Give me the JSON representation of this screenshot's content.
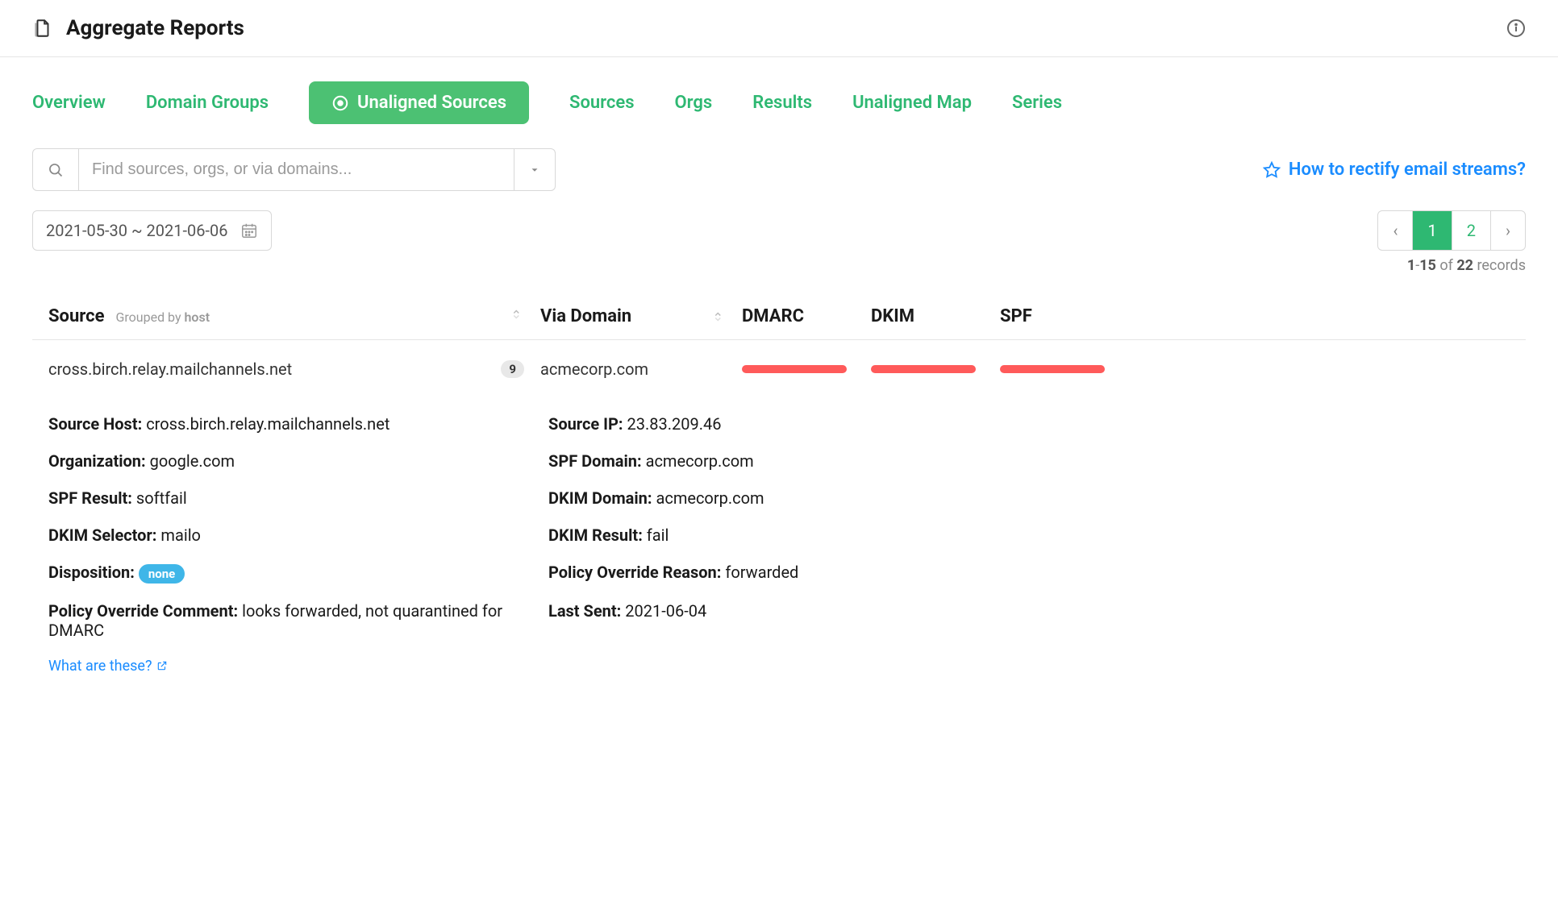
{
  "header": {
    "title": "Aggregate Reports"
  },
  "tabs": {
    "items": [
      {
        "label": "Overview"
      },
      {
        "label": "Domain Groups"
      },
      {
        "label": "Unaligned Sources"
      },
      {
        "label": "Sources"
      },
      {
        "label": "Orgs"
      },
      {
        "label": "Results"
      },
      {
        "label": "Unaligned Map"
      },
      {
        "label": "Series"
      }
    ],
    "activeIndex": 2
  },
  "search": {
    "placeholder": "Find sources, orgs, or via domains..."
  },
  "helpLink": "How to rectify email streams?",
  "dateRange": "2021-05-30 ~ 2021-06-06",
  "pagination": {
    "pages": [
      "1",
      "2"
    ],
    "activePage": "1",
    "rangeStart": "1",
    "rangeEnd": "15",
    "total": "22",
    "recordsWord": "records",
    "ofWord": "of"
  },
  "tableHeaders": {
    "source": "Source",
    "groupedBy": "Grouped by",
    "groupedByField": "host",
    "viaDomain": "Via Domain",
    "dmarc": "DMARC",
    "dkim": "DKIM",
    "spf": "SPF"
  },
  "row": {
    "source": "cross.birch.relay.mailchannels.net",
    "count": "9",
    "viaDomain": "acmecorp.com"
  },
  "details": {
    "sourceHostLabel": "Source Host:",
    "sourceHost": "cross.birch.relay.mailchannels.net",
    "sourceIpLabel": "Source IP:",
    "sourceIp": "23.83.209.46",
    "orgLabel": "Organization:",
    "org": "google.com",
    "spfDomainLabel": "SPF Domain:",
    "spfDomain": "acmecorp.com",
    "spfResultLabel": "SPF Result:",
    "spfResult": "softfail",
    "dkimDomainLabel": "DKIM Domain:",
    "dkimDomain": "acmecorp.com",
    "dkimSelectorLabel": "DKIM Selector:",
    "dkimSelector": "mailo",
    "dkimResultLabel": "DKIM Result:",
    "dkimResult": "fail",
    "dispositionLabel": "Disposition:",
    "disposition": "none",
    "policyOverrideReasonLabel": "Policy Override Reason:",
    "policyOverrideReason": "forwarded",
    "policyOverrideCommentLabel": "Policy Override Comment:",
    "policyOverrideComment": "looks forwarded, not quarantined for DMARC",
    "lastSentLabel": "Last Sent:",
    "lastSent": "2021-06-04",
    "whatAreThese": "What are these?"
  }
}
